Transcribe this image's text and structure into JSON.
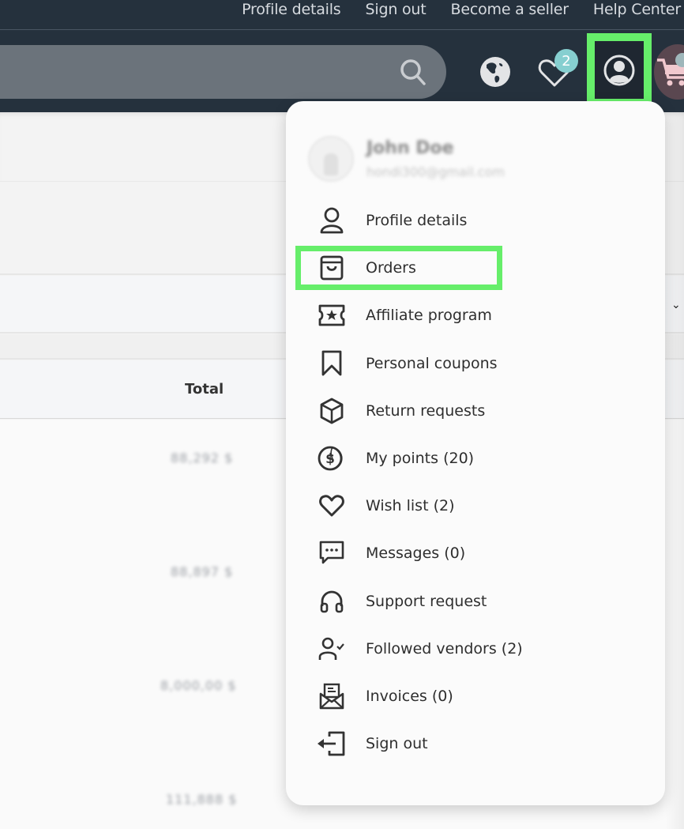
{
  "header": {
    "top_links": [
      "Profile details",
      "Sign out",
      "Become a seller",
      "Help Center"
    ],
    "search": {
      "placeholder": "",
      "icon": "search-icon"
    },
    "wishlist_badge": "2",
    "icons": [
      "globe-icon",
      "heart-icon",
      "user-circle-icon",
      "cart-icon"
    ]
  },
  "page": {
    "table": {
      "header_total": "Total",
      "totals": [
        "88,292 $",
        "88,897 $",
        "8,000,00 $",
        "111,888 $"
      ]
    }
  },
  "dropdown": {
    "user_name": "John Doe",
    "user_email": "hondi300@gmail.com",
    "items": [
      {
        "label": "Profile details",
        "icon": "user-icon"
      },
      {
        "label": "Orders",
        "icon": "shopping-bag-icon",
        "highlighted": true
      },
      {
        "label": "Affiliate program",
        "icon": "ticket-star-icon"
      },
      {
        "label": "Personal coupons",
        "icon": "bookmark-icon"
      },
      {
        "label": "Return requests",
        "icon": "box-icon"
      },
      {
        "label": "My points (20)",
        "icon": "coins-icon"
      },
      {
        "label": "Wish list (2)",
        "icon": "heart-icon"
      },
      {
        "label": "Messages (0)",
        "icon": "message-icon"
      },
      {
        "label": "Support request",
        "icon": "headphones-icon"
      },
      {
        "label": "Followed vendors (2)",
        "icon": "user-check-icon"
      },
      {
        "label": "Invoices (0)",
        "icon": "invoice-envelope-icon"
      },
      {
        "label": "Sign out",
        "icon": "sign-out-icon"
      }
    ]
  },
  "colors": {
    "header_bg": "#25313d",
    "search_bg": "#6b737b",
    "highlight": "#66ee6a",
    "badge": "#86cfd0"
  }
}
